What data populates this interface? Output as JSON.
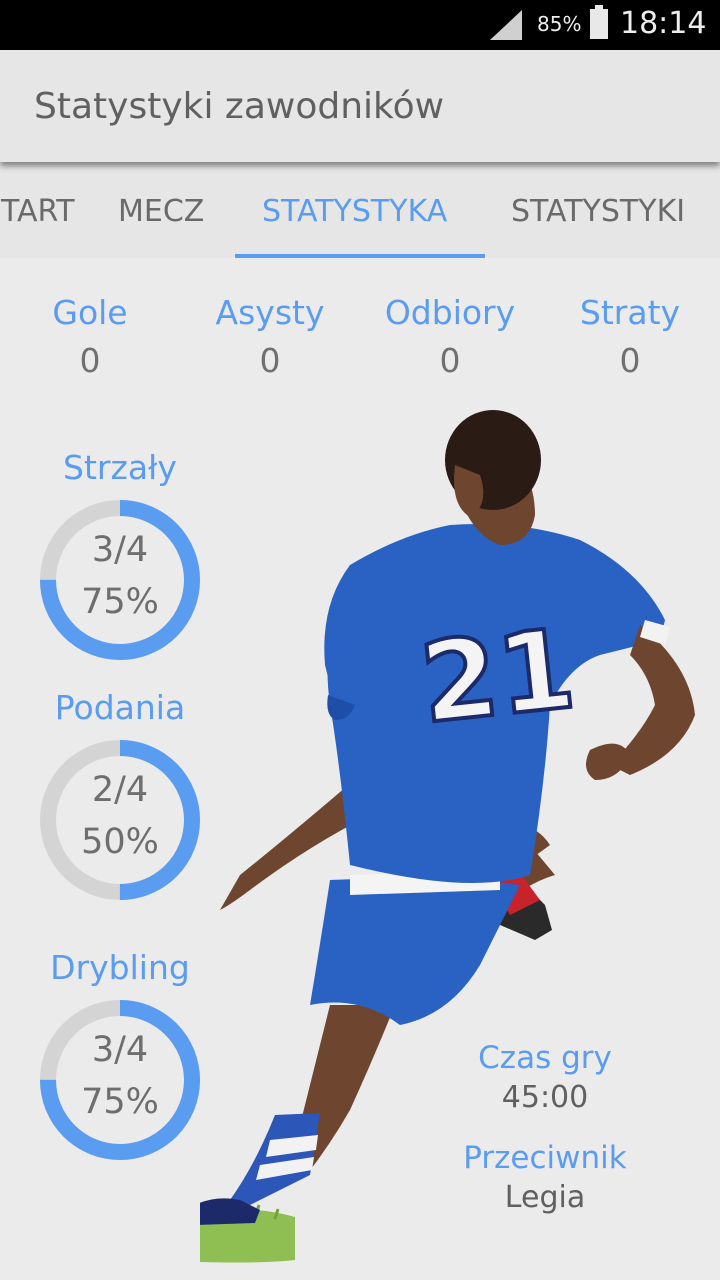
{
  "status_bar": {
    "battery_pct": "85%",
    "time": "18:14"
  },
  "app_bar": {
    "title": "Statystyki zawodników"
  },
  "tabs": [
    {
      "label": "START"
    },
    {
      "label": "MECZ"
    },
    {
      "label": "STATYSTYKA",
      "selected": true
    },
    {
      "label": "STATYSTYKI"
    }
  ],
  "stats": [
    {
      "label": "Gole",
      "value": "0"
    },
    {
      "label": "Asysty",
      "value": "0"
    },
    {
      "label": "Odbiory",
      "value": "0"
    },
    {
      "label": "Straty",
      "value": "0"
    }
  ],
  "rings": [
    {
      "label": "Strzały",
      "fraction": "3/4",
      "percent": "75%",
      "progress": 0.75
    },
    {
      "label": "Podania",
      "fraction": "2/4",
      "percent": "50%",
      "progress": 0.5
    },
    {
      "label": "Drybling",
      "fraction": "3/4",
      "percent": "75%",
      "progress": 0.75
    }
  ],
  "info": {
    "time_label": "Czas gry",
    "time_value": "45:00",
    "opponent_label": "Przeciwnik",
    "opponent_value": "Legia"
  },
  "player": {
    "shirt_number": "21"
  },
  "colors": {
    "accent": "#5a9cf0",
    "ring_track": "#d4d4d4",
    "jersey": "#2a62c4"
  }
}
